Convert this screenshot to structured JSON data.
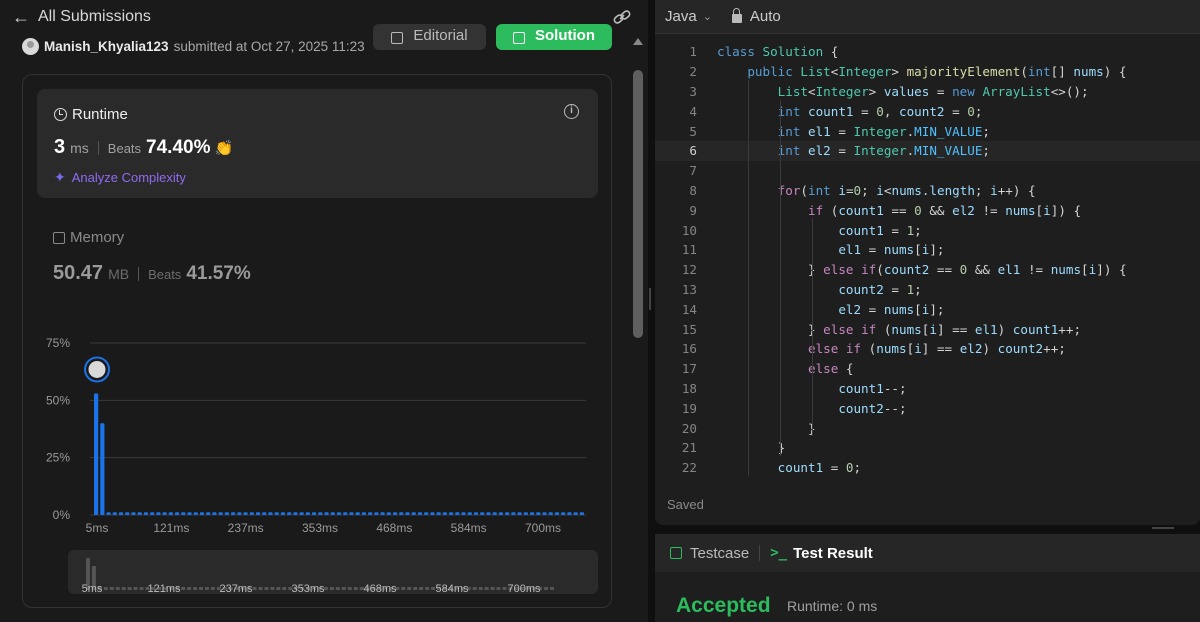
{
  "header": {
    "back_label": "All Submissions"
  },
  "submission": {
    "username": "Manish_Khyalia123",
    "submitted_text": "submitted at Oct 27, 2025 11:23"
  },
  "buttons": {
    "editorial": "Editorial",
    "solution": "Solution"
  },
  "runtime": {
    "title": "Runtime",
    "value": "3",
    "unit": "ms",
    "beats_label": "Beats",
    "beats_pct": "74.40%",
    "analyze_label": "Analyze Complexity"
  },
  "memory": {
    "title": "Memory",
    "value": "50.47",
    "unit": "MB",
    "beats_label": "Beats",
    "beats_pct": "41.57%"
  },
  "chart_data": {
    "type": "bar",
    "title": "",
    "ytick_labels": [
      "75%",
      "50%",
      "25%",
      "0%"
    ],
    "ylim": [
      0,
      75
    ],
    "xtick_labels": [
      "5ms",
      "121ms",
      "237ms",
      "353ms",
      "468ms",
      "584ms",
      "700ms"
    ],
    "highlight_index": 0,
    "series": [
      {
        "values": [
          53,
          40,
          1.2,
          1.2,
          1.2,
          1.2,
          1.2,
          1.2,
          1.2,
          1.2,
          1.2,
          1.2,
          1.2,
          1.2,
          1.2,
          1.2,
          1.2,
          1.2,
          1.2,
          1.2,
          1.2,
          1.2,
          1.2,
          1.2,
          1.2,
          1.2,
          1.2,
          1.2,
          1.2,
          1.2,
          1.2,
          1.2,
          1.2,
          1.2,
          1.2,
          1.2,
          1.2,
          1.2,
          1.2,
          1.2,
          1.2,
          1.2,
          1.2,
          1.2,
          1.2,
          1.2,
          1.2,
          1.2,
          1.2,
          1.2,
          1.2,
          1.2,
          1.2,
          1.2,
          1.2,
          1.2,
          1.2,
          1.2,
          1.2,
          1.2,
          1.2,
          1.2,
          1.2,
          1.2,
          1.2,
          1.2,
          1.2,
          1.2,
          1.2,
          1.2,
          1.2,
          1.2,
          1.2,
          1.2,
          1.2,
          1.2,
          1.2,
          1.2,
          1.2
        ]
      }
    ],
    "colors": {
      "bar": "#1a73e8",
      "grid": "#3a3a3a",
      "mini_bar": "#555555"
    }
  },
  "editor": {
    "language": "Java",
    "mode": "Auto",
    "saved_label": "Saved",
    "active_line": 6,
    "lines": [
      [
        [
          "class ",
          "#569cd6"
        ],
        [
          "Solution",
          "#4ec9b0"
        ],
        [
          " {",
          "#d4d4d4"
        ]
      ],
      [
        [
          "    public ",
          "#569cd6"
        ],
        [
          "List",
          "#4ec9b0"
        ],
        [
          "<",
          "#d4d4d4"
        ],
        [
          "Integer",
          "#4ec9b0"
        ],
        [
          "> ",
          "#d4d4d4"
        ],
        [
          "majorityElement",
          "#dcdcaa"
        ],
        [
          "(",
          "#d4d4d4"
        ],
        [
          "int",
          "#569cd6"
        ],
        [
          "[] ",
          "#d4d4d4"
        ],
        [
          "nums",
          "#9cdcfe"
        ],
        [
          ") {",
          "#d4d4d4"
        ]
      ],
      [
        [
          "        List",
          "#4ec9b0"
        ],
        [
          "<",
          "#d4d4d4"
        ],
        [
          "Integer",
          "#4ec9b0"
        ],
        [
          "> ",
          "#d4d4d4"
        ],
        [
          "values",
          "#9cdcfe"
        ],
        [
          " = ",
          "#d4d4d4"
        ],
        [
          "new ",
          "#569cd6"
        ],
        [
          "ArrayList",
          "#4ec9b0"
        ],
        [
          "<>();",
          "#d4d4d4"
        ]
      ],
      [
        [
          "        int ",
          "#569cd6"
        ],
        [
          "count1",
          "#9cdcfe"
        ],
        [
          " = ",
          "#d4d4d4"
        ],
        [
          "0",
          "#b5cea8"
        ],
        [
          ", ",
          "#d4d4d4"
        ],
        [
          "count2",
          "#9cdcfe"
        ],
        [
          " = ",
          "#d4d4d4"
        ],
        [
          "0",
          "#b5cea8"
        ],
        [
          ";",
          "#d4d4d4"
        ]
      ],
      [
        [
          "        int ",
          "#569cd6"
        ],
        [
          "el1",
          "#9cdcfe"
        ],
        [
          " = ",
          "#d4d4d4"
        ],
        [
          "Integer",
          "#4ec9b0"
        ],
        [
          ".",
          "#d4d4d4"
        ],
        [
          "MIN_VALUE",
          "#4fc1ff"
        ],
        [
          ";",
          "#d4d4d4"
        ]
      ],
      [
        [
          "        int ",
          "#569cd6"
        ],
        [
          "el2",
          "#9cdcfe"
        ],
        [
          " = ",
          "#d4d4d4"
        ],
        [
          "Integer",
          "#4ec9b0"
        ],
        [
          ".",
          "#d4d4d4"
        ],
        [
          "MIN_VALUE",
          "#4fc1ff"
        ],
        [
          ";",
          "#d4d4d4"
        ]
      ],
      [
        [
          "",
          "#d4d4d4"
        ]
      ],
      [
        [
          "        for",
          "#c586c0"
        ],
        [
          "(",
          "#d4d4d4"
        ],
        [
          "int ",
          "#569cd6"
        ],
        [
          "i",
          "#9cdcfe"
        ],
        [
          "=",
          "#d4d4d4"
        ],
        [
          "0",
          "#b5cea8"
        ],
        [
          "; ",
          "#d4d4d4"
        ],
        [
          "i",
          "#9cdcfe"
        ],
        [
          "<",
          "#d4d4d4"
        ],
        [
          "nums",
          "#9cdcfe"
        ],
        [
          ".",
          "#d4d4d4"
        ],
        [
          "length",
          "#9cdcfe"
        ],
        [
          "; ",
          "#d4d4d4"
        ],
        [
          "i",
          "#9cdcfe"
        ],
        [
          "++) {",
          "#d4d4d4"
        ]
      ],
      [
        [
          "            if ",
          "#c586c0"
        ],
        [
          "(",
          "#d4d4d4"
        ],
        [
          "count1",
          "#9cdcfe"
        ],
        [
          " == ",
          "#d4d4d4"
        ],
        [
          "0",
          "#b5cea8"
        ],
        [
          " && ",
          "#d4d4d4"
        ],
        [
          "el2",
          "#9cdcfe"
        ],
        [
          " != ",
          "#d4d4d4"
        ],
        [
          "nums",
          "#9cdcfe"
        ],
        [
          "[",
          "#d4d4d4"
        ],
        [
          "i",
          "#9cdcfe"
        ],
        [
          "]) {",
          "#d4d4d4"
        ]
      ],
      [
        [
          "                count1",
          "#9cdcfe"
        ],
        [
          " = ",
          "#d4d4d4"
        ],
        [
          "1",
          "#b5cea8"
        ],
        [
          ";",
          "#d4d4d4"
        ]
      ],
      [
        [
          "                el1",
          "#9cdcfe"
        ],
        [
          " = ",
          "#d4d4d4"
        ],
        [
          "nums",
          "#9cdcfe"
        ],
        [
          "[",
          "#d4d4d4"
        ],
        [
          "i",
          "#9cdcfe"
        ],
        [
          "];",
          "#d4d4d4"
        ]
      ],
      [
        [
          "            } ",
          "#d4d4d4"
        ],
        [
          "else if",
          "#c586c0"
        ],
        [
          "(",
          "#d4d4d4"
        ],
        [
          "count2",
          "#9cdcfe"
        ],
        [
          " == ",
          "#d4d4d4"
        ],
        [
          "0",
          "#b5cea8"
        ],
        [
          " && ",
          "#d4d4d4"
        ],
        [
          "el1",
          "#9cdcfe"
        ],
        [
          " != ",
          "#d4d4d4"
        ],
        [
          "nums",
          "#9cdcfe"
        ],
        [
          "[",
          "#d4d4d4"
        ],
        [
          "i",
          "#9cdcfe"
        ],
        [
          "]) {",
          "#d4d4d4"
        ]
      ],
      [
        [
          "                count2",
          "#9cdcfe"
        ],
        [
          " = ",
          "#d4d4d4"
        ],
        [
          "1",
          "#b5cea8"
        ],
        [
          ";",
          "#d4d4d4"
        ]
      ],
      [
        [
          "                el2",
          "#9cdcfe"
        ],
        [
          " = ",
          "#d4d4d4"
        ],
        [
          "nums",
          "#9cdcfe"
        ],
        [
          "[",
          "#d4d4d4"
        ],
        [
          "i",
          "#9cdcfe"
        ],
        [
          "];",
          "#d4d4d4"
        ]
      ],
      [
        [
          "            } ",
          "#d4d4d4"
        ],
        [
          "else if ",
          "#c586c0"
        ],
        [
          "(",
          "#d4d4d4"
        ],
        [
          "nums",
          "#9cdcfe"
        ],
        [
          "[",
          "#d4d4d4"
        ],
        [
          "i",
          "#9cdcfe"
        ],
        [
          "] == ",
          "#d4d4d4"
        ],
        [
          "el1",
          "#9cdcfe"
        ],
        [
          ") ",
          "#d4d4d4"
        ],
        [
          "count1",
          "#9cdcfe"
        ],
        [
          "++;",
          "#d4d4d4"
        ]
      ],
      [
        [
          "            else if ",
          "#c586c0"
        ],
        [
          "(",
          "#d4d4d4"
        ],
        [
          "nums",
          "#9cdcfe"
        ],
        [
          "[",
          "#d4d4d4"
        ],
        [
          "i",
          "#9cdcfe"
        ],
        [
          "] == ",
          "#d4d4d4"
        ],
        [
          "el2",
          "#9cdcfe"
        ],
        [
          ") ",
          "#d4d4d4"
        ],
        [
          "count2",
          "#9cdcfe"
        ],
        [
          "++;",
          "#d4d4d4"
        ]
      ],
      [
        [
          "            else ",
          "#c586c0"
        ],
        [
          "{",
          "#d4d4d4"
        ]
      ],
      [
        [
          "                count1",
          "#9cdcfe"
        ],
        [
          "--;",
          "#d4d4d4"
        ]
      ],
      [
        [
          "                count2",
          "#9cdcfe"
        ],
        [
          "--;",
          "#d4d4d4"
        ]
      ],
      [
        [
          "            }",
          "#d4d4d4"
        ]
      ],
      [
        [
          "        }",
          "#d4d4d4"
        ]
      ],
      [
        [
          "        count1",
          "#9cdcfe"
        ],
        [
          " = ",
          "#d4d4d4"
        ],
        [
          "0",
          "#b5cea8"
        ],
        [
          ";",
          "#d4d4d4"
        ]
      ]
    ]
  },
  "result": {
    "tab_testcase": "Testcase",
    "tab_result": "Test Result",
    "status": "Accepted",
    "runtime_text": "Runtime: 0 ms"
  }
}
